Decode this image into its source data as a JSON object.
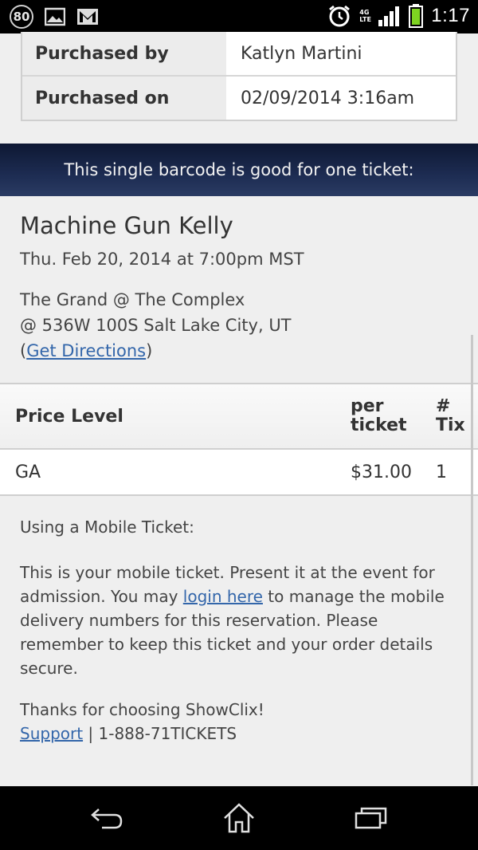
{
  "status_bar": {
    "notification_badge": "80",
    "network_type": "4G LTE",
    "time": "1:17",
    "icons": [
      "image-icon",
      "gmail-icon",
      "alarm-icon",
      "signal-icon",
      "battery-icon"
    ]
  },
  "purchase": {
    "rows": [
      {
        "label": "Purchased by",
        "value": "Katlyn Martini"
      },
      {
        "label": "Purchased on",
        "value": "02/09/2014 3:16am"
      }
    ]
  },
  "banner": {
    "text": "This single barcode is good for one ticket:"
  },
  "event": {
    "title": "Machine Gun Kelly",
    "date": "Thu. Feb 20, 2014 at 7:00pm MST",
    "venue_name": "The Grand @ The Complex",
    "venue_address": "@ 536W 100S Salt Lake City, UT",
    "directions_open": "(",
    "directions_link": "Get Directions",
    "directions_close": ")"
  },
  "price_table": {
    "headers": {
      "level": "Price Level",
      "per_1": "per",
      "per_2": "ticket",
      "tix_1": "#",
      "tix_2": "Tix"
    },
    "rows": [
      {
        "level": "GA",
        "per_ticket": "$31.00",
        "tix": "1"
      }
    ]
  },
  "mobile": {
    "heading": "Using a Mobile Ticket:",
    "body_1": "This is your mobile ticket. Present it at the event for admission. You may ",
    "login_link": "login here",
    "body_2": " to manage the mobile delivery numbers for this reservation. Please remember to keep this ticket and your order details secure.",
    "thanks": "Thanks for choosing ShowClix!",
    "support_link": "Support",
    "support_sep": " | ",
    "phone": "1-888-71TICKETS"
  },
  "nav": {
    "icons": [
      "back-icon",
      "home-icon",
      "recent-apps-icon"
    ]
  },
  "colors": {
    "banner": "#1d2c52",
    "link": "#3366aa",
    "background": "#efefef"
  }
}
